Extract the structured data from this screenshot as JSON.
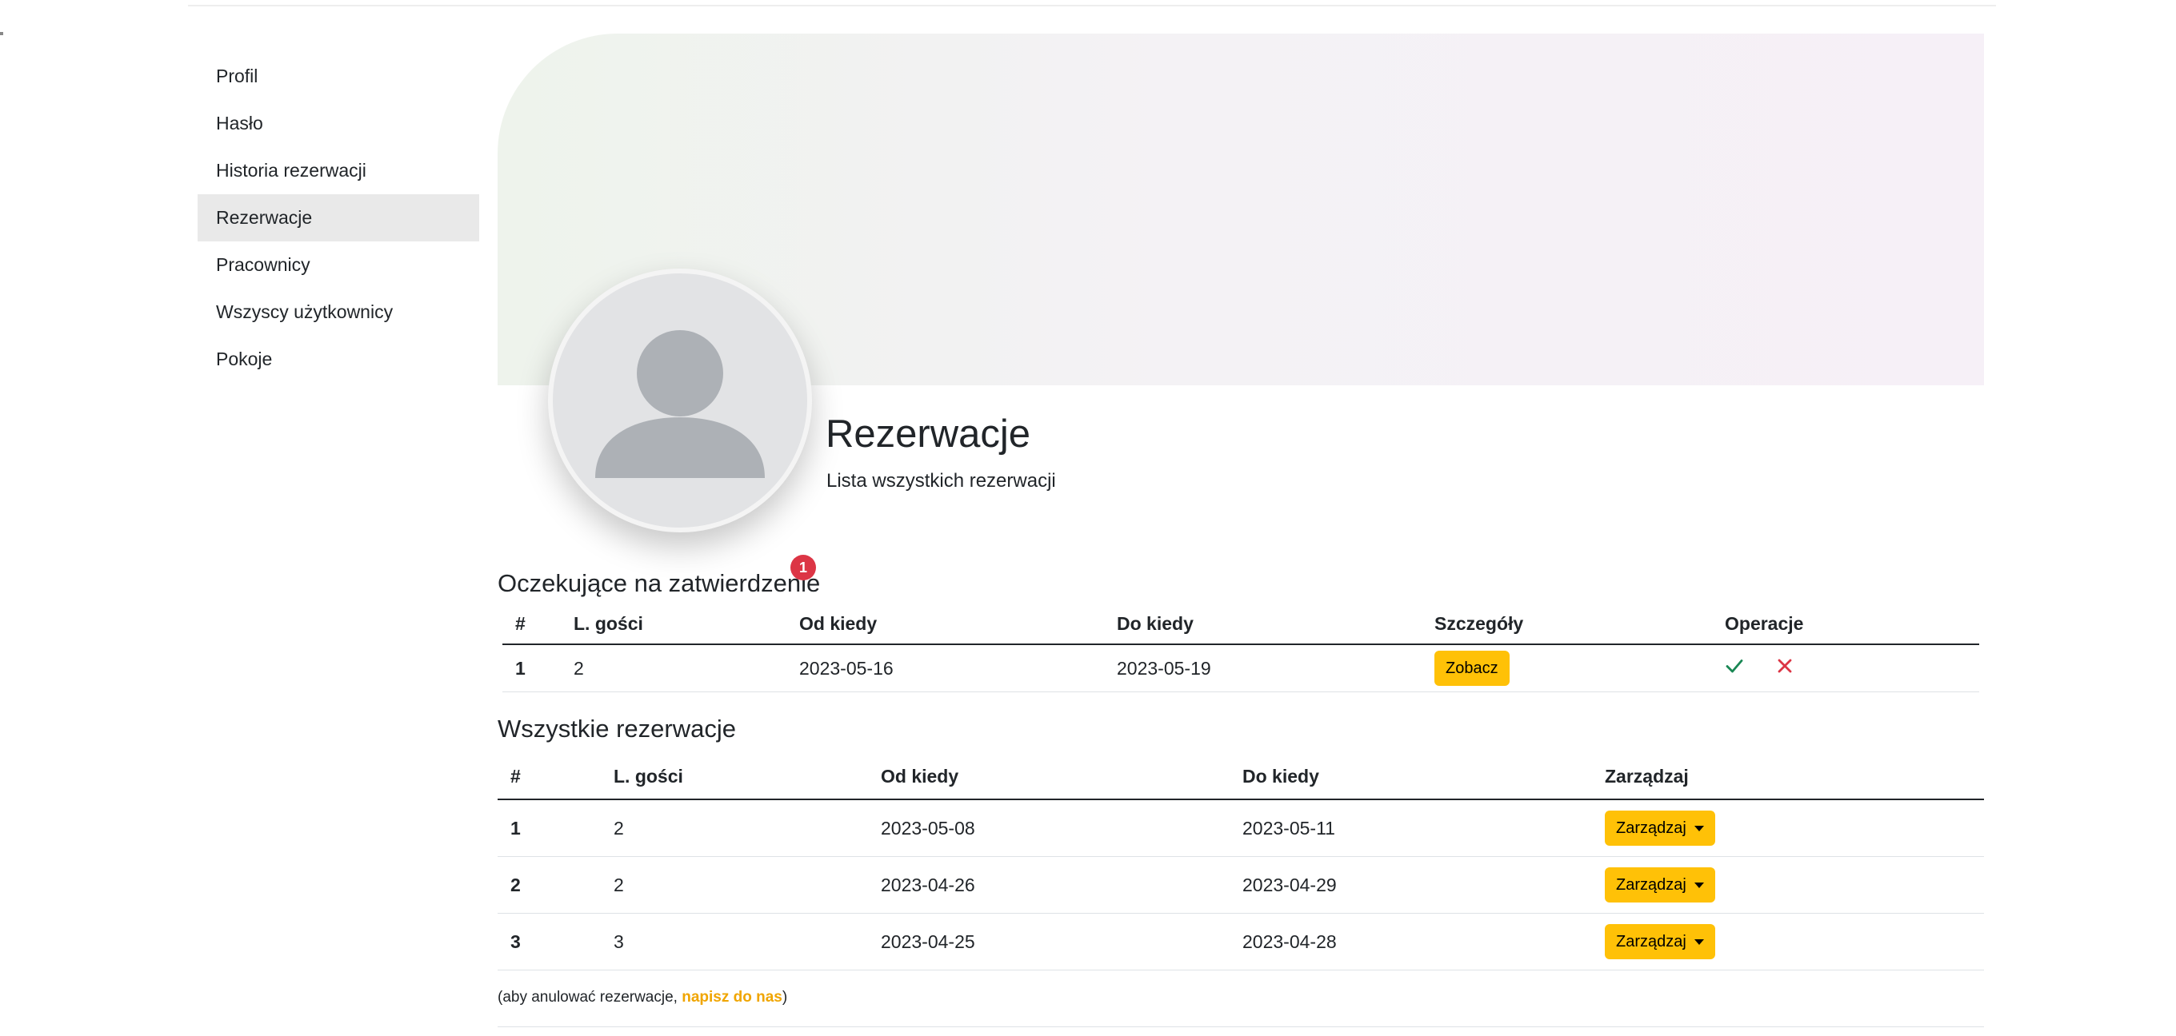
{
  "sidebar": {
    "items": [
      {
        "label": "Profil"
      },
      {
        "label": "Hasło"
      },
      {
        "label": "Historia rezerwacji"
      },
      {
        "label": "Rezerwacje",
        "active": true
      },
      {
        "label": "Pracownicy"
      },
      {
        "label": "Wszyscy użytkownicy"
      },
      {
        "label": "Pokoje"
      }
    ]
  },
  "header": {
    "title": "Rezerwacje",
    "subtitle": "Lista wszystkich rezerwacji"
  },
  "pending": {
    "title": "Oczekujące na zatwierdzenie",
    "badge": "1",
    "columns": [
      "#",
      "L. gości",
      "Od kiedy",
      "Do kiedy",
      "Szczegóły",
      "Operacje"
    ],
    "rows": [
      {
        "num": "1",
        "guests": "2",
        "from": "2023-05-16",
        "to": "2023-05-19",
        "details_label": "Zobacz"
      }
    ],
    "approve_icon": "check-icon",
    "reject_icon": "close-icon",
    "approve_color": "#198754",
    "reject_color": "#dc3545"
  },
  "all": {
    "title": "Wszystkie rezerwacje",
    "columns": [
      "#",
      "L. gości",
      "Od kiedy",
      "Do kiedy",
      "Zarządzaj"
    ],
    "rows": [
      {
        "num": "1",
        "guests": "2",
        "from": "2023-05-08",
        "to": "2023-05-11",
        "manage_label": "Zarządzaj"
      },
      {
        "num": "2",
        "guests": "2",
        "from": "2023-04-26",
        "to": "2023-04-29",
        "manage_label": "Zarządzaj"
      },
      {
        "num": "3",
        "guests": "3",
        "from": "2023-04-25",
        "to": "2023-04-28",
        "manage_label": "Zarządzaj"
      }
    ]
  },
  "footer_note": {
    "prefix": "(aby anulować rezerwacje, ",
    "link": "napisz do nas",
    "suffix": ")"
  },
  "colors": {
    "accent": "#ffc107",
    "badge": "#dc3545",
    "link": "#f0a500"
  }
}
